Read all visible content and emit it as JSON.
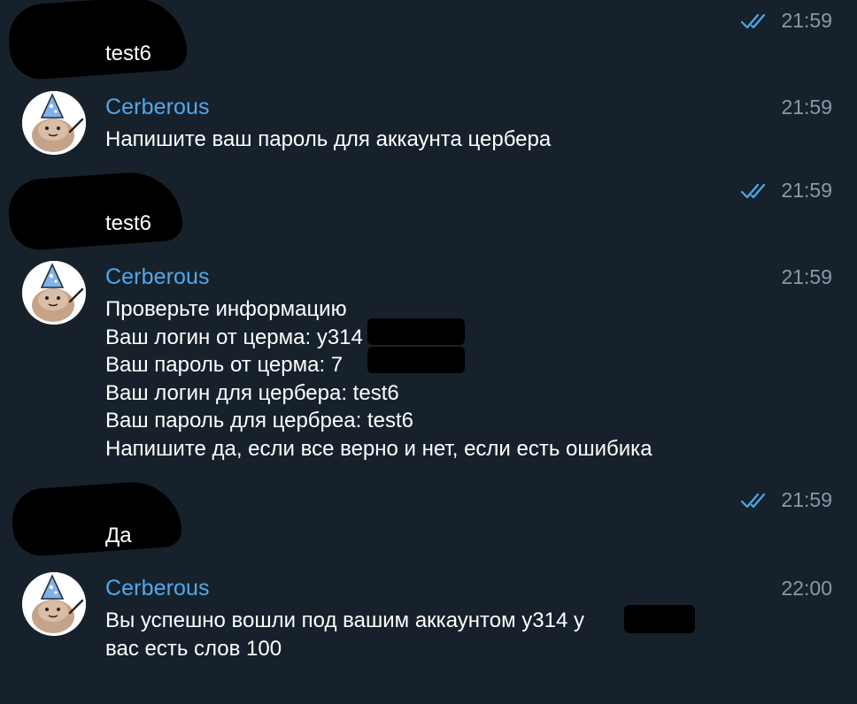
{
  "colors": {
    "background": "#17212b",
    "sender_name": "#4fa9ea",
    "message_text": "#ffffff",
    "timestamp": "#8a98a8",
    "read_checks": "#4fa9ea"
  },
  "messages": [
    {
      "from": "user",
      "text": "test6",
      "time": "21:59",
      "status_icon": "double-check-read-icon"
    },
    {
      "from": "bot",
      "sender": "Cerberous",
      "text": "Напишите ваш пароль для аккаунта цербера",
      "time": "21:59"
    },
    {
      "from": "user",
      "text": "test6",
      "time": "21:59",
      "status_icon": "double-check-read-icon"
    },
    {
      "from": "bot",
      "sender": "Cerberous",
      "text": "Проверьте информацию\nВаш логин от церма: у314\nВаш пароль от церма: 7\nВаш логин для цербера: test6\nВаш пароль для цербреа: test6\nНапишите да, если все верно и нет, если есть ошибика",
      "time": "21:59"
    },
    {
      "from": "user",
      "text": "Да",
      "time": "21:59",
      "status_icon": "double-check-read-icon"
    },
    {
      "from": "bot",
      "sender": "Cerberous",
      "text": "Вы успешно вошли под вашим аккаунтом у314            у\nвас есть слов 100",
      "time": "22:00"
    }
  ]
}
